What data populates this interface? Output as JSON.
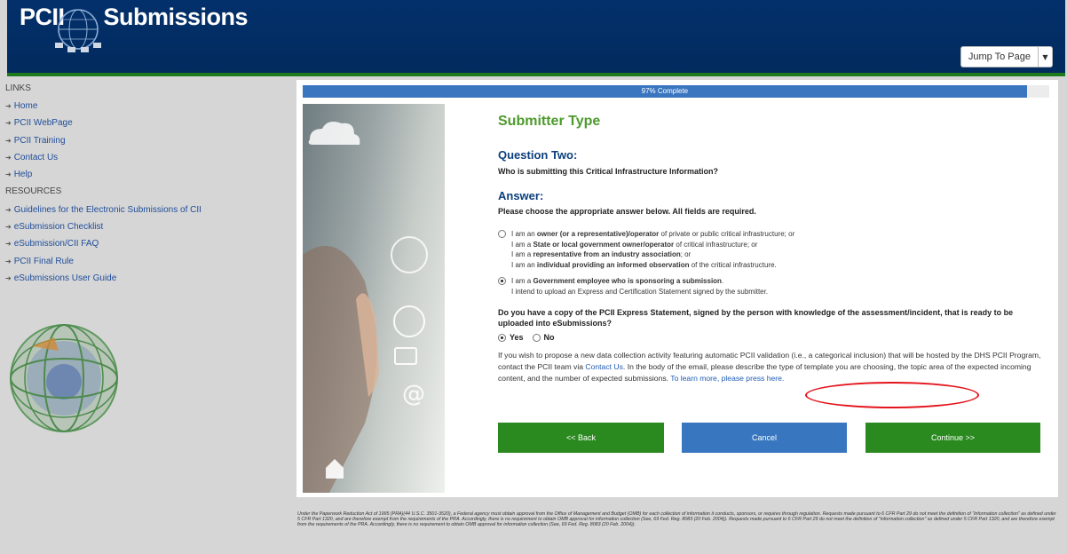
{
  "header": {
    "logo_left": "PCII",
    "logo_right": "Submissions",
    "jump_label": "Jump To Page",
    "jump_caret_icon": "chevron-down-icon"
  },
  "sidebar": {
    "links_heading": "LINKS",
    "links": [
      {
        "label": "Home"
      },
      {
        "label": "PCII WebPage"
      },
      {
        "label": "PCII Training"
      },
      {
        "label": "Contact Us"
      },
      {
        "label": "Help"
      }
    ],
    "resources_heading": "RESOURCES",
    "resources": [
      {
        "label": "Guidelines for the Electronic Submissions of CII"
      },
      {
        "label": "eSubmission Checklist"
      },
      {
        "label": "eSubmission/CII FAQ"
      },
      {
        "label": "PCII Final Rule"
      },
      {
        "label": "eSubmissions User Guide"
      }
    ]
  },
  "progress": {
    "label": "97% Complete",
    "percent": 97
  },
  "main": {
    "title": "Submitter Type",
    "question_heading": "Question Two:",
    "question_text": "Who is submitting this Critical Infrastructure Information?",
    "answer_heading": "Answer:",
    "answer_instruction": "Please choose the appropriate answer below. All fields are required.",
    "option1": {
      "selected": false,
      "l1a": "I am an ",
      "l1b": "owner (or a representative)/operator",
      "l1c": " of private or public critical infrastructure; or",
      "l2a": "I am a ",
      "l2b": "State or local government owner/operator",
      "l2c": " of critical infrastructure; or",
      "l3a": "I am a ",
      "l3b": "representative from an industry association",
      "l3c": "; or",
      "l4a": "I am an ",
      "l4b": "individual providing an informed observation",
      "l4c": " of the critical infrastructure."
    },
    "option2": {
      "selected": true,
      "l1a": "I am a ",
      "l1b": "Government employee who is sponsoring a submission",
      "l1c": ".",
      "l2": "I intend to upload an Express and Certification Statement signed by the submitter."
    },
    "copy_question": "Do you have a copy of the PCII Express Statement, signed by the person with knowledge of the assessment/incident, that is ready to be uploaded into eSubmissions?",
    "yes_label": "Yes",
    "no_label": "No",
    "yes_selected": true,
    "info_a": "If you wish to propose a new data collection activity featuring automatic PCII validation (i.e., a categorical inclusion) that will be hosted by the DHS PCII Program, contact the PCII team via ",
    "info_link": "Contact Us",
    "info_b": ". In the body of the email, please describe the type of template you are choosing, the topic area of the expected incoming content, and the number of expected submissions. ",
    "info_link2": "To learn more, please press here.",
    "back_label": "<< Back",
    "cancel_label": "Cancel",
    "continue_label": "Continue >>"
  },
  "footer": {
    "text": "Under the Paperwork Reduction Act of 1995 (PRA)(44 U.S.C. 3501-3520), a Federal agency must obtain approval from the Office of Management and Budget (OMB) for each collection of information it conducts, sponsors, or requires through regulation. Requests made pursuant to 6 CFR Part 29 do not meet the definition of \"information collection\" as defined under 5 CFR Part 1320, and are therefore exempt from the requirements of the PRA. Accordingly, there is no requirement to obtain OMB approval for information collection (See, 69 Fed. Reg. 8083 (20 Feb. 2004)). Requests made pursuant to 6 CFR Part 29 do not meet the definition of \"information collection\" as defined under 5 CFR Part 1320, and are therefore exempt from the requirements of the PRA. Accordingly, there is no requirement to obtain OMB approval for information collection (See, 69 Fed. Reg. 8083 (20 Feb. 2004))."
  },
  "colors": {
    "header_bg": "#03306b",
    "accent_green": "#2a8a1f",
    "accent_blue": "#3876bf",
    "title_green": "#4d9a2c",
    "highlight_red": "#e4141c"
  }
}
